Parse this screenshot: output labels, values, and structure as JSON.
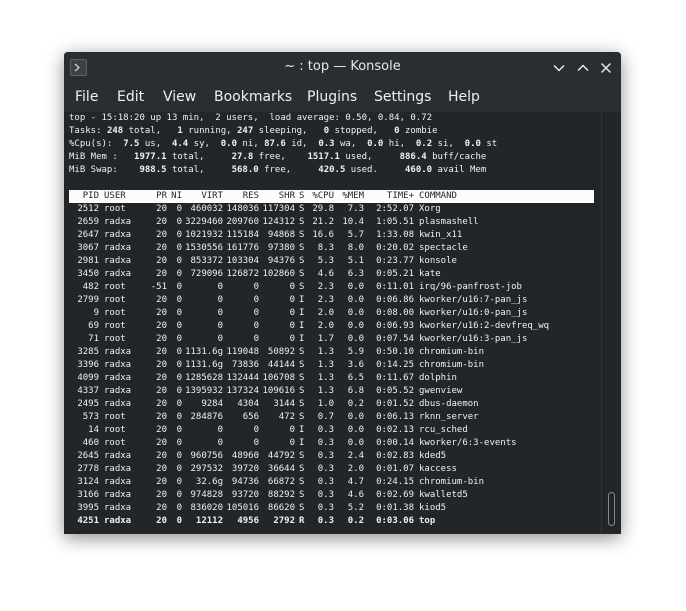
{
  "window": {
    "title": "~ : top — Konsole",
    "buttons": {
      "minimize": "chevron-down",
      "maximize": "chevron-up",
      "close": "x"
    }
  },
  "menubar": {
    "items": [
      "File",
      "Edit",
      "View",
      "Bookmarks",
      "Plugins",
      "Settings",
      "Help"
    ]
  },
  "summary": {
    "line1": "top - 15:18:20 up 13 min,  2 users,  load average: 0.50, 0.84, 0.72",
    "tasks": [
      {
        "t": "Tasks: ",
        "b": false
      },
      {
        "t": "248",
        "b": true
      },
      {
        "t": " total,   ",
        "b": false
      },
      {
        "t": "1",
        "b": true
      },
      {
        "t": " running, ",
        "b": false
      },
      {
        "t": "247",
        "b": true
      },
      {
        "t": " sleeping,   ",
        "b": false
      },
      {
        "t": "0",
        "b": true
      },
      {
        "t": " stopped,   ",
        "b": false
      },
      {
        "t": "0",
        "b": true
      },
      {
        "t": " zombie",
        "b": false
      }
    ],
    "cpu": [
      {
        "t": "%Cpu(s):  ",
        "b": false
      },
      {
        "t": "7.5",
        "b": true
      },
      {
        "t": " us,  ",
        "b": false
      },
      {
        "t": "4.4",
        "b": true
      },
      {
        "t": " sy,  ",
        "b": false
      },
      {
        "t": "0.0",
        "b": true
      },
      {
        "t": " ni, ",
        "b": false
      },
      {
        "t": "87.6",
        "b": true
      },
      {
        "t": " id,  ",
        "b": false
      },
      {
        "t": "0.3",
        "b": true
      },
      {
        "t": " wa,  ",
        "b": false
      },
      {
        "t": "0.0",
        "b": true
      },
      {
        "t": " hi,  ",
        "b": false
      },
      {
        "t": "0.2",
        "b": true
      },
      {
        "t": " si,  ",
        "b": false
      },
      {
        "t": "0.0",
        "b": true
      },
      {
        "t": " st",
        "b": false
      }
    ],
    "mem": [
      {
        "t": "MiB Mem :   ",
        "b": false
      },
      {
        "t": "1977.1",
        "b": true
      },
      {
        "t": " total,     ",
        "b": false
      },
      {
        "t": "27.8",
        "b": true
      },
      {
        "t": " free,    ",
        "b": false
      },
      {
        "t": "1517.1",
        "b": true
      },
      {
        "t": " used,     ",
        "b": false
      },
      {
        "t": "886.4",
        "b": true
      },
      {
        "t": " buff/cache",
        "b": false
      }
    ],
    "swap": [
      {
        "t": "MiB Swap:    ",
        "b": false
      },
      {
        "t": "988.5",
        "b": true
      },
      {
        "t": " total,     ",
        "b": false
      },
      {
        "t": "568.0",
        "b": true
      },
      {
        "t": " free,     ",
        "b": false
      },
      {
        "t": "420.5",
        "b": true
      },
      {
        "t": " used.     ",
        "b": false
      },
      {
        "t": "460.0",
        "b": true
      },
      {
        "t": " avail Mem",
        "b": false
      }
    ]
  },
  "table": {
    "columns": [
      "PID",
      "USER",
      "PR",
      "NI",
      "VIRT",
      "RES",
      "SHR",
      "S",
      "%CPU",
      "%MEM",
      "TIME+",
      "COMMAND"
    ],
    "rows": [
      [
        "2512",
        "root",
        "20",
        "0",
        "460032",
        "148036",
        "117304",
        "S",
        "29.8",
        "7.3",
        "2:52.07",
        "Xorg"
      ],
      [
        "2659",
        "radxa",
        "20",
        "0",
        "3229460",
        "209760",
        "124312",
        "S",
        "21.2",
        "10.4",
        "1:05.51",
        "plasmashell"
      ],
      [
        "2647",
        "radxa",
        "20",
        "0",
        "1021932",
        "115184",
        "94868",
        "S",
        "16.6",
        "5.7",
        "1:33.08",
        "kwin_x11"
      ],
      [
        "3067",
        "radxa",
        "20",
        "0",
        "1530556",
        "161776",
        "97380",
        "S",
        "8.3",
        "8.0",
        "0:20.02",
        "spectacle"
      ],
      [
        "2981",
        "radxa",
        "20",
        "0",
        "853372",
        "103304",
        "94376",
        "S",
        "5.3",
        "5.1",
        "0:23.77",
        "konsole"
      ],
      [
        "3450",
        "radxa",
        "20",
        "0",
        "729096",
        "126872",
        "102860",
        "S",
        "4.6",
        "6.3",
        "0:05.21",
        "kate"
      ],
      [
        "482",
        "root",
        "-51",
        "0",
        "0",
        "0",
        "0",
        "S",
        "2.3",
        "0.0",
        "0:11.01",
        "irq/96-panfrost-job"
      ],
      [
        "2799",
        "root",
        "20",
        "0",
        "0",
        "0",
        "0",
        "I",
        "2.3",
        "0.0",
        "0:06.86",
        "kworker/u16:7-pan_js"
      ],
      [
        "9",
        "root",
        "20",
        "0",
        "0",
        "0",
        "0",
        "I",
        "2.0",
        "0.0",
        "0:08.00",
        "kworker/u16:0-pan_js"
      ],
      [
        "69",
        "root",
        "20",
        "0",
        "0",
        "0",
        "0",
        "I",
        "2.0",
        "0.0",
        "0:06.93",
        "kworker/u16:2-devfreq_wq"
      ],
      [
        "71",
        "root",
        "20",
        "0",
        "0",
        "0",
        "0",
        "I",
        "1.7",
        "0.0",
        "0:07.54",
        "kworker/u16:3-pan_js"
      ],
      [
        "3285",
        "radxa",
        "20",
        "0",
        "1131.6g",
        "119048",
        "50892",
        "S",
        "1.3",
        "5.9",
        "0:50.10",
        "chromium-bin"
      ],
      [
        "3396",
        "radxa",
        "20",
        "0",
        "1131.6g",
        "73836",
        "44144",
        "S",
        "1.3",
        "3.6",
        "0:14.25",
        "chromium-bin"
      ],
      [
        "4099",
        "radxa",
        "20",
        "0",
        "1285628",
        "132444",
        "106708",
        "S",
        "1.3",
        "6.5",
        "0:11.67",
        "dolphin"
      ],
      [
        "4337",
        "radxa",
        "20",
        "0",
        "1395932",
        "137324",
        "109616",
        "S",
        "1.3",
        "6.8",
        "0:05.52",
        "gwenview"
      ],
      [
        "2495",
        "radxa",
        "20",
        "0",
        "9284",
        "4304",
        "3144",
        "S",
        "1.0",
        "0.2",
        "0:01.52",
        "dbus-daemon"
      ],
      [
        "573",
        "root",
        "20",
        "0",
        "284876",
        "656",
        "472",
        "S",
        "0.7",
        "0.0",
        "0:06.13",
        "rknn_server"
      ],
      [
        "14",
        "root",
        "20",
        "0",
        "0",
        "0",
        "0",
        "I",
        "0.3",
        "0.0",
        "0:02.13",
        "rcu_sched"
      ],
      [
        "460",
        "root",
        "20",
        "0",
        "0",
        "0",
        "0",
        "I",
        "0.3",
        "0.0",
        "0:00.14",
        "kworker/6:3-events"
      ],
      [
        "2645",
        "radxa",
        "20",
        "0",
        "960756",
        "48960",
        "44792",
        "S",
        "0.3",
        "2.4",
        "0:02.83",
        "kded5"
      ],
      [
        "2778",
        "radxa",
        "20",
        "0",
        "297532",
        "39720",
        "36644",
        "S",
        "0.3",
        "2.0",
        "0:01.07",
        "kaccess"
      ],
      [
        "3124",
        "radxa",
        "20",
        "0",
        "32.6g",
        "94736",
        "66872",
        "S",
        "0.3",
        "4.7",
        "0:24.15",
        "chromium-bin"
      ],
      [
        "3166",
        "radxa",
        "20",
        "0",
        "974828",
        "93720",
        "88292",
        "S",
        "0.3",
        "4.6",
        "0:02.69",
        "kwalletd5"
      ],
      [
        "3995",
        "radxa",
        "20",
        "0",
        "836020",
        "105016",
        "86620",
        "S",
        "0.3",
        "5.2",
        "0:01.38",
        "kiod5"
      ],
      [
        "4251",
        "radxa",
        "20",
        "0",
        "12112",
        "4956",
        "2792",
        "R",
        "0.3",
        "0.2",
        "0:03.06",
        "top"
      ]
    ],
    "bold_row_index": 24
  }
}
